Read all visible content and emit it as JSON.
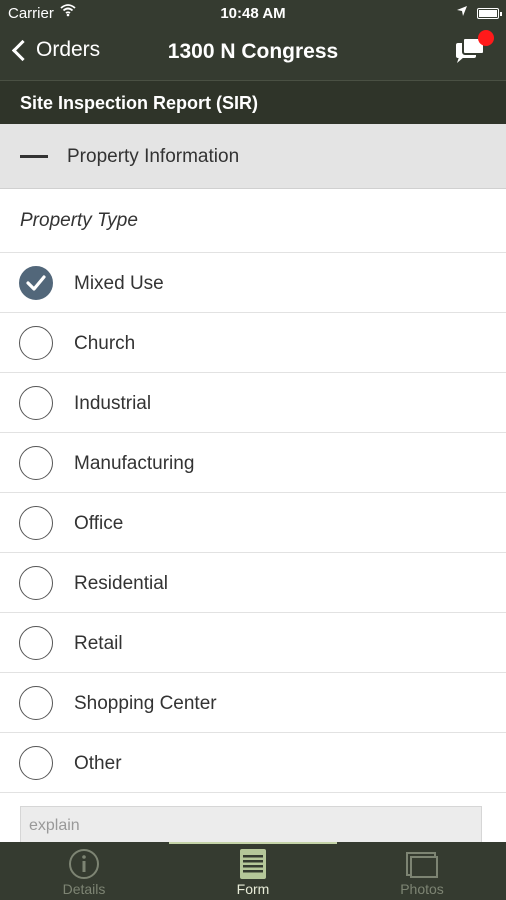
{
  "status": {
    "carrier": "Carrier",
    "time": "10:48 AM"
  },
  "nav": {
    "back_label": "Orders",
    "title": "1300 N Congress"
  },
  "form": {
    "title": "Site Inspection Report (SIR)",
    "section_title": "Property Information",
    "question": "Property Type",
    "options": [
      {
        "label": "Mixed Use",
        "selected": true
      },
      {
        "label": "Church",
        "selected": false
      },
      {
        "label": "Industrial",
        "selected": false
      },
      {
        "label": "Manufacturing",
        "selected": false
      },
      {
        "label": "Office",
        "selected": false
      },
      {
        "label": "Residential",
        "selected": false
      },
      {
        "label": "Retail",
        "selected": false
      },
      {
        "label": "Shopping Center",
        "selected": false
      },
      {
        "label": "Other",
        "selected": false
      }
    ],
    "explain_placeholder": "explain"
  },
  "tabs": [
    {
      "label": "Details",
      "icon": "info-icon",
      "active": false
    },
    {
      "label": "Form",
      "icon": "form-icon",
      "active": true
    },
    {
      "label": "Photos",
      "icon": "photos-icon",
      "active": false
    }
  ],
  "colors": {
    "header_bg": "#353b30",
    "radio_checked": "#52677a",
    "notification_badge": "#ff1a1a",
    "active_tab_indicator": "#c5d4a8"
  }
}
